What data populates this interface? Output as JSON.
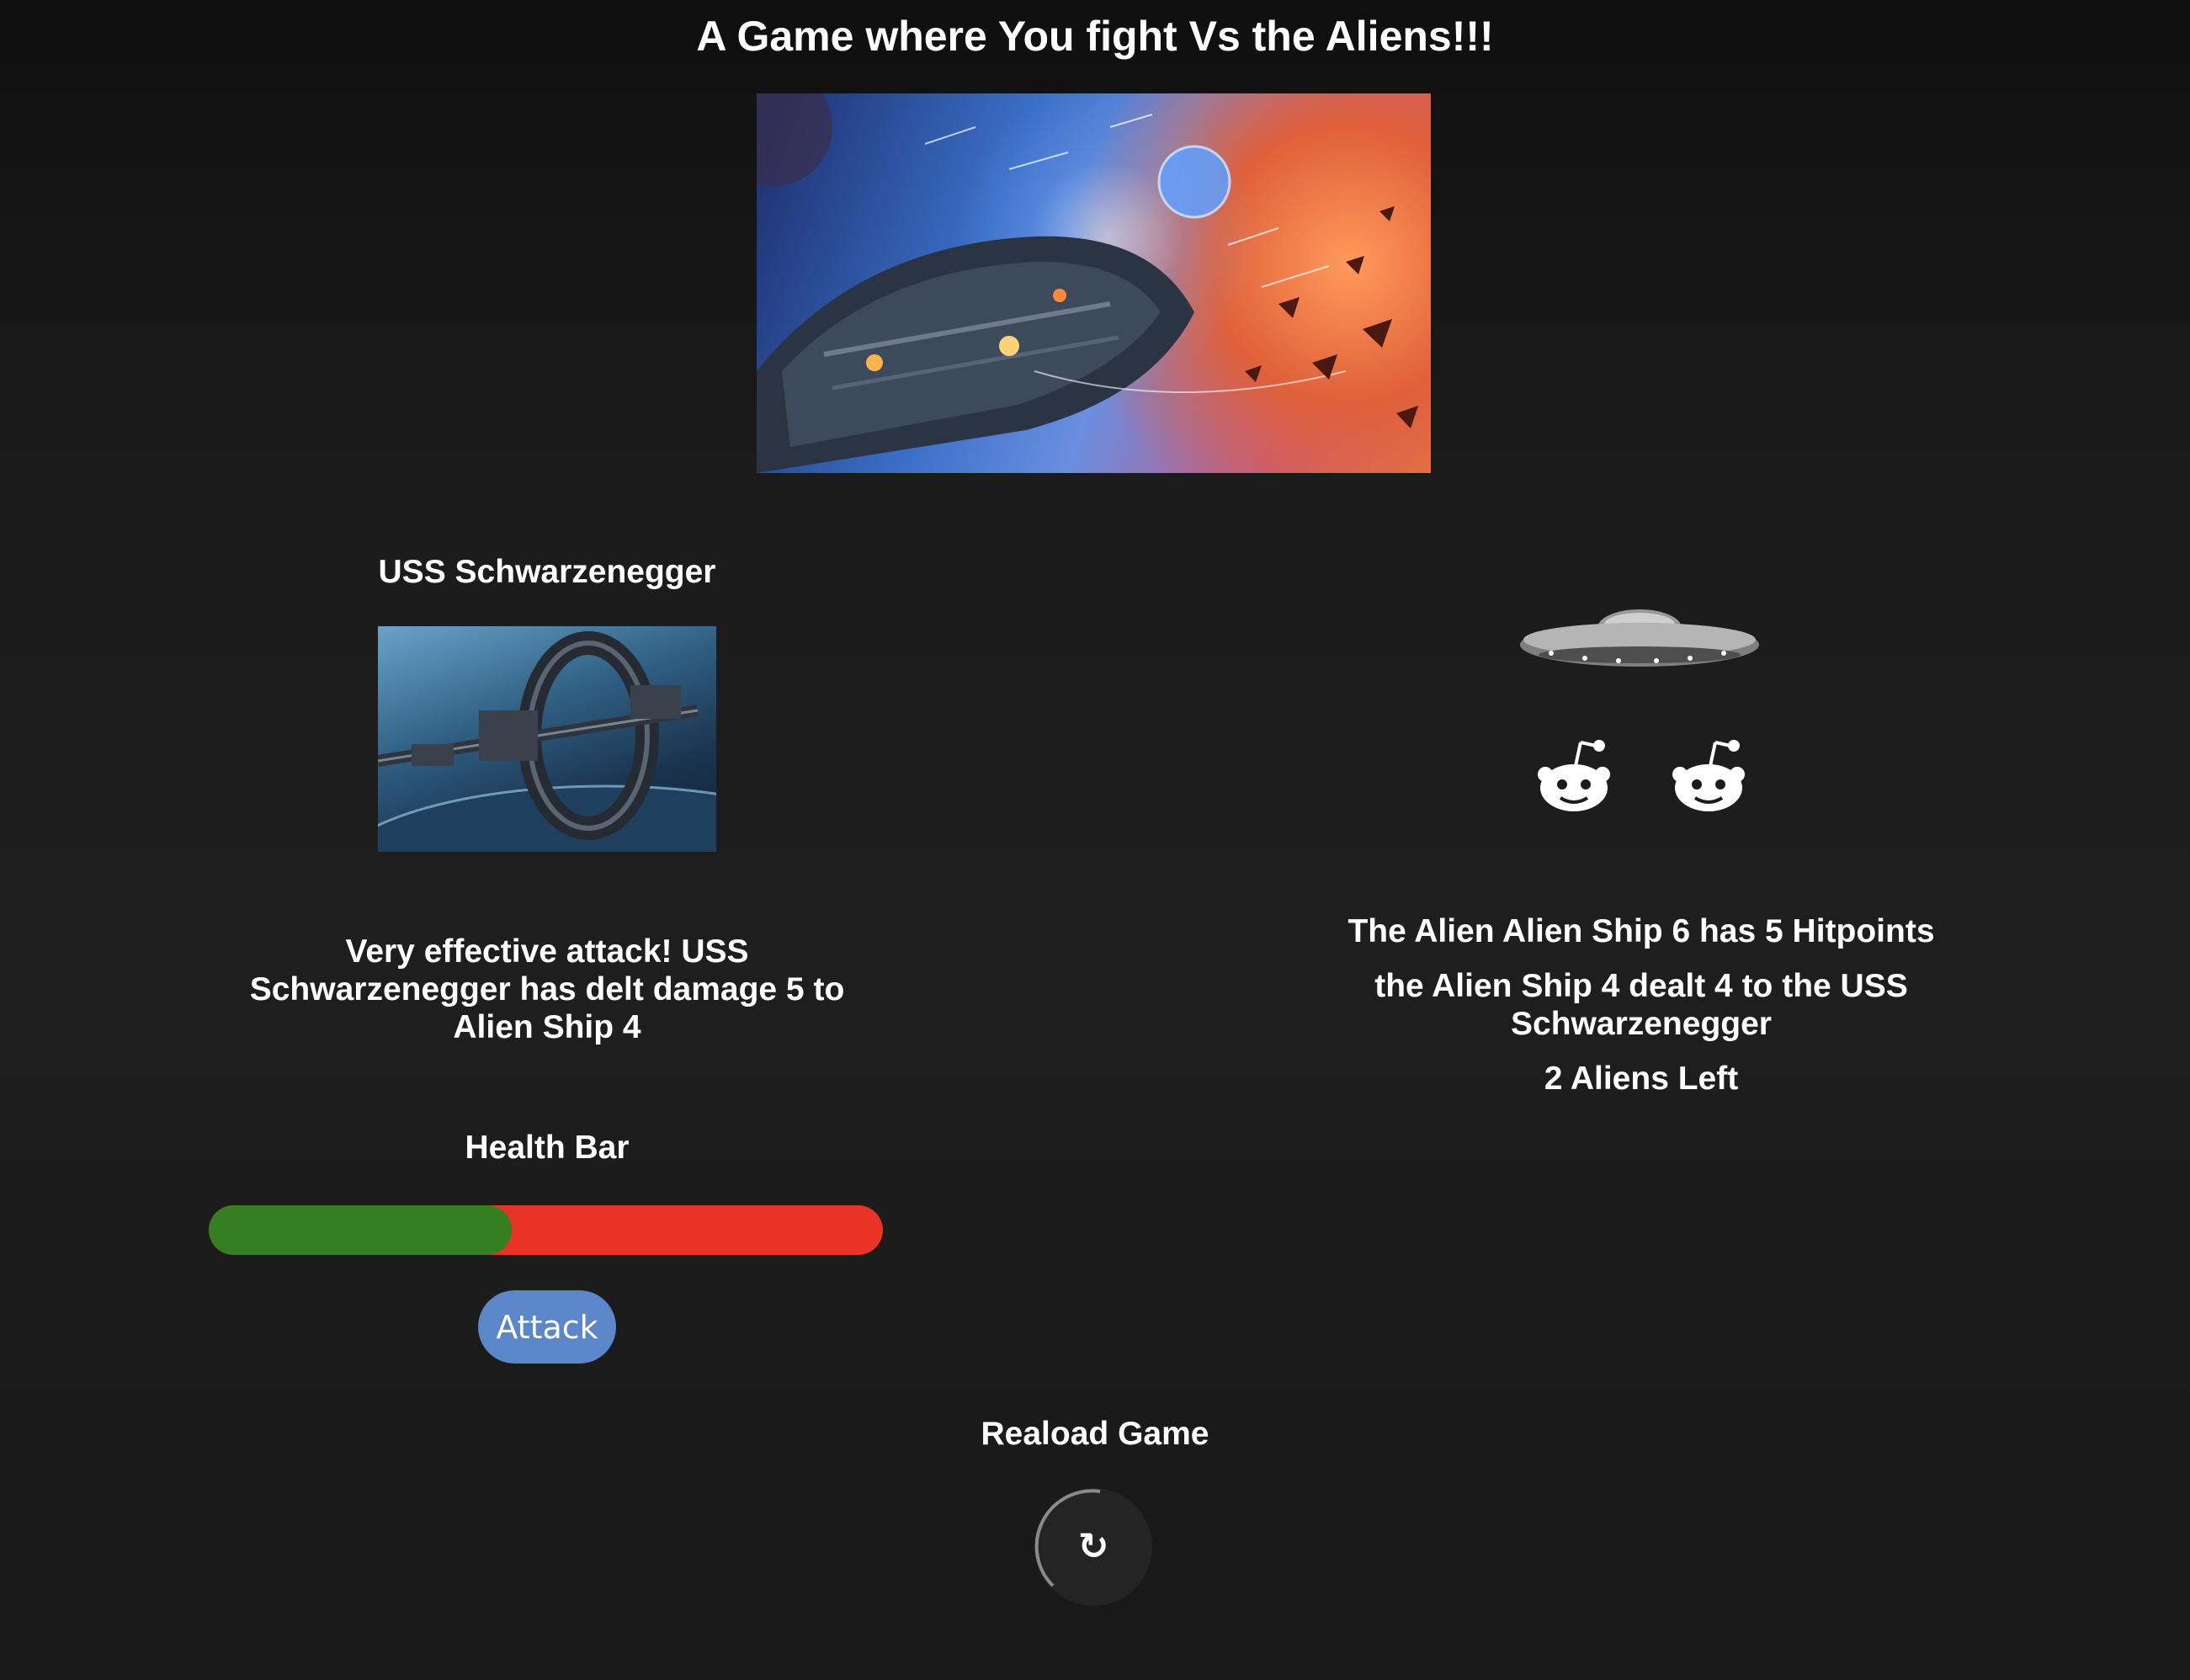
{
  "page": {
    "title": "A Game where You fight Vs the Aliens!!!"
  },
  "player": {
    "ship_name": "USS Schwarzenegger",
    "log": "Very effective attack! USS Schwarzenegger has delt damage 5 to Alien Ship 4",
    "health_label": "Health Bar",
    "health_fraction": 0.45,
    "attack_label": "Attack"
  },
  "aliens": {
    "remaining_icon_count": 2,
    "hitpoints_text": "The Alien Alien Ship 6 has 5 Hitpoints",
    "damage_text": "the Alien Ship 4 dealt 4 to the USS Schwarzenegger",
    "remaining_text": "2 Aliens Left",
    "icon": "reddit-alien-icon"
  },
  "reload": {
    "label": "Reaload Game",
    "icon": "reload-icon",
    "glyph": "↻"
  },
  "colors": {
    "health_remaining": "#357e22",
    "health_lost": "#e83326",
    "attack_button": "#5b86c7"
  }
}
